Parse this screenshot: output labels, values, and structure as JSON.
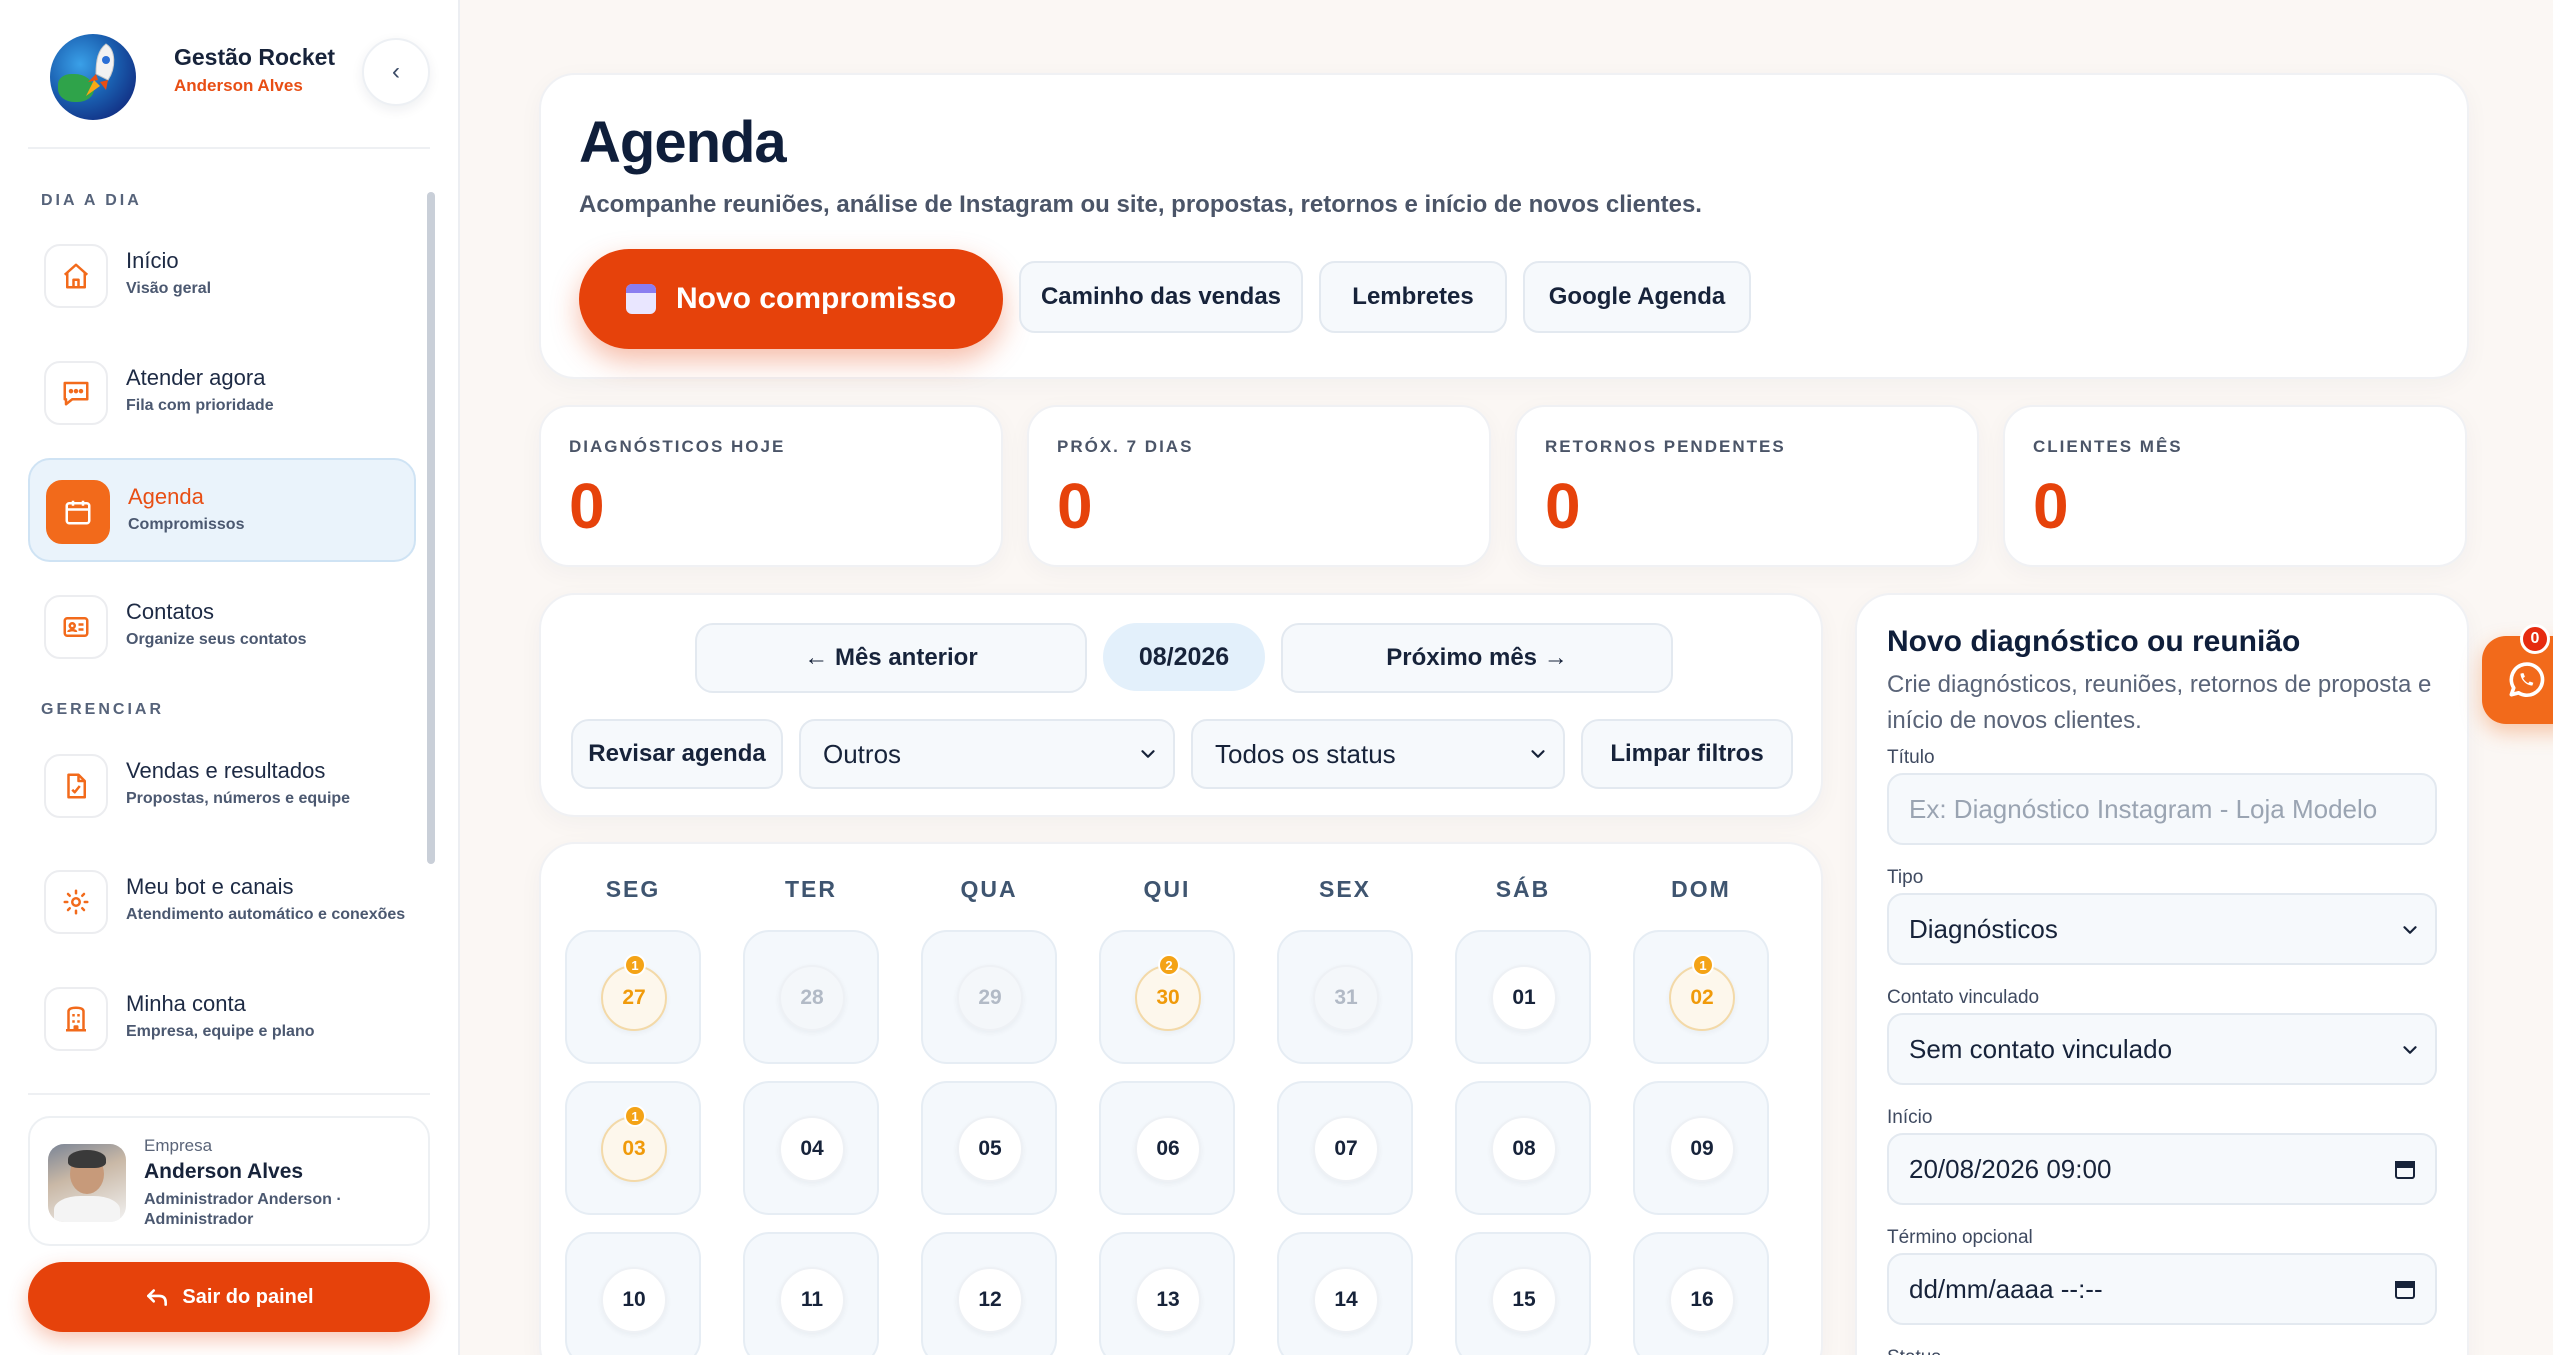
{
  "brand": {
    "name": "Gestão Rocket",
    "user": "Anderson Alves",
    "collapse_glyph": "‹"
  },
  "sidebar": {
    "section_day": "DIA A DIA",
    "section_manage": "GERENCIAR",
    "items": [
      {
        "title": "Início",
        "subtitle": "Visão geral",
        "icon": "home-icon"
      },
      {
        "title": "Atender agora",
        "subtitle": "Fila com prioridade",
        "icon": "chat-icon"
      },
      {
        "title": "Agenda",
        "subtitle": "Compromissos",
        "icon": "calendar-icon",
        "active": true
      },
      {
        "title": "Contatos",
        "subtitle": "Organize seus contatos",
        "icon": "contact-card-icon"
      },
      {
        "title": "Vendas e resultados",
        "subtitle": "Propostas, números e equipe",
        "icon": "document-icon"
      },
      {
        "title": "Meu bot e canais",
        "subtitle": "Atendimento automático e conexões",
        "icon": "sun-gear-icon"
      },
      {
        "title": "Minha conta",
        "subtitle": "Empresa, equipe e plano",
        "icon": "building-icon"
      }
    ],
    "profile": {
      "label": "Empresa",
      "name": "Anderson Alves",
      "role": "Administrador Anderson · Administrador"
    },
    "logout_label": "Sair do painel"
  },
  "header": {
    "title": "Agenda",
    "subtitle": "Acompanhe reuniões, análise de Instagram ou site, propostas, retornos e início de novos clientes.",
    "primary_button": "Novo compromisso",
    "buttons": [
      "Caminho das vendas",
      "Lembretes",
      "Google Agenda"
    ]
  },
  "stats": [
    {
      "label": "DIAGNÓSTICOS HOJE",
      "value": "0"
    },
    {
      "label": "PRÓX. 7 DIAS",
      "value": "0"
    },
    {
      "label": "RETORNOS PENDENTES",
      "value": "0"
    },
    {
      "label": "CLIENTES MÊS",
      "value": "0"
    }
  ],
  "filters": {
    "prev_month": "← Mês anterior",
    "current_month": "08/2026",
    "next_month": "Próximo mês →",
    "review": "Revisar agenda",
    "type_selected": "Outros",
    "status_selected": "Todos os status",
    "clear": "Limpar filtros"
  },
  "calendar": {
    "weekdays": [
      "SEG",
      "TER",
      "QUA",
      "QUI",
      "SEX",
      "SÁB",
      "DOM"
    ],
    "days": [
      {
        "n": "27",
        "muted": true,
        "count": "1"
      },
      {
        "n": "28",
        "muted": true
      },
      {
        "n": "29",
        "muted": true
      },
      {
        "n": "30",
        "muted": true,
        "count": "2"
      },
      {
        "n": "31",
        "muted": true
      },
      {
        "n": "01"
      },
      {
        "n": "02",
        "count": "1"
      },
      {
        "n": "03",
        "count": "1"
      },
      {
        "n": "04"
      },
      {
        "n": "05"
      },
      {
        "n": "06"
      },
      {
        "n": "07"
      },
      {
        "n": "08"
      },
      {
        "n": "09"
      },
      {
        "n": "10"
      },
      {
        "n": "11"
      },
      {
        "n": "12"
      },
      {
        "n": "13"
      },
      {
        "n": "14"
      },
      {
        "n": "15"
      },
      {
        "n": "16"
      }
    ]
  },
  "form": {
    "title": "Novo diagnóstico ou reunião",
    "subtitle": "Crie diagnósticos, reuniões, retornos de proposta e início de novos clientes.",
    "title_label": "Título",
    "title_placeholder": "Ex: Diagnóstico Instagram - Loja Modelo",
    "type_label": "Tipo",
    "type_value": "Diagnósticos",
    "contact_label": "Contato vinculado",
    "contact_value": "Sem contato vinculado",
    "start_label": "Início",
    "start_value": "20/08/2026 09:00",
    "end_label": "Término opcional",
    "end_value": "dd/mm/aaaa --:--",
    "status_label": "Status"
  },
  "whatsapp": {
    "badge": "0",
    "icon": "whatsapp-icon"
  },
  "colors": {
    "accent": "#e6420b",
    "accent_soft": "#f26a1b",
    "event": "#f4a316",
    "active_bg": "#eaf3fb"
  }
}
